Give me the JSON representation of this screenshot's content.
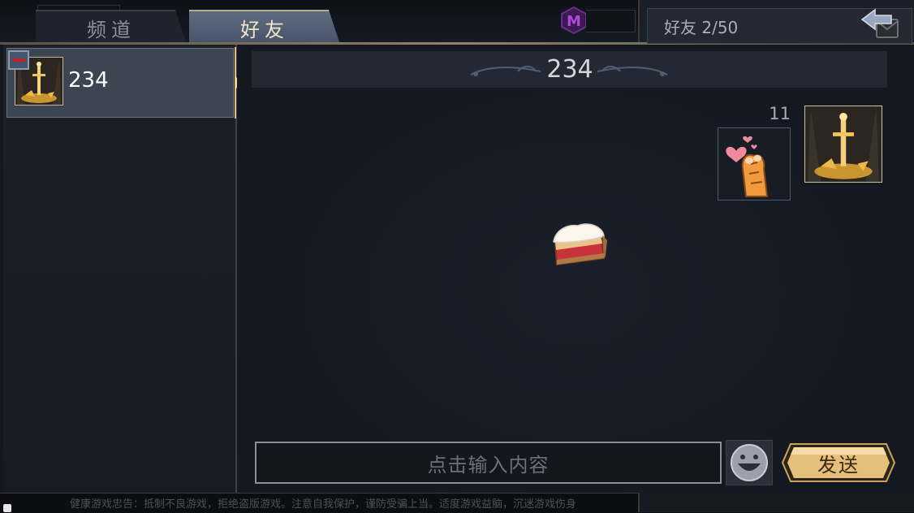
{
  "tabs": {
    "channels_label": "频道",
    "friends_label": "好友"
  },
  "header": {
    "friend_count": "好友 2/50"
  },
  "friend_list": {
    "items": [
      {
        "name": "234"
      }
    ]
  },
  "chat": {
    "title": "234",
    "messages": [
      {
        "time": "11",
        "content_icon": "heart-paw-sticker"
      }
    ]
  },
  "input": {
    "placeholder": "点击输入内容"
  },
  "send_button_label": "发送",
  "footer": {
    "notice": "健康游戏忠告：抵制不良游戏，拒绝盗版游戏。注意自我保护，谨防受骗上当。适度游戏益脑，沉迷游戏伤身"
  },
  "colors": {
    "accent_gold": "#e9c47a",
    "tab_active": "#5f6c80",
    "remove_red": "#c0242a"
  }
}
